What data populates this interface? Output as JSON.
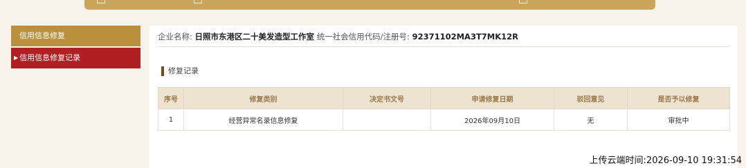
{
  "sidebar": {
    "items": [
      {
        "label": "信用信息修复"
      },
      {
        "label": "信用信息修复记录"
      }
    ]
  },
  "company": {
    "name_label": "企业名称:",
    "name_value": "日照市东港区二十美发造型工作室",
    "code_label": "统一社会信用代码/注册号:",
    "code_value": "92371102MA3T7MK12R"
  },
  "section": {
    "title": "修复记录"
  },
  "table": {
    "headers": [
      "序号",
      "修复类别",
      "决定书文号",
      "申请修复日期",
      "驳回意见",
      "是否予以修复"
    ],
    "rows": [
      [
        "1",
        "经营异常名录信息修复",
        "",
        "2026年09月10日",
        "无",
        "审批中"
      ]
    ]
  },
  "footer": {
    "upload_time": "上传云端时间:2026-09-10 19:31:54"
  },
  "colors": {
    "gold": "#b9903c",
    "red": "#b11f22",
    "banner": "#c9a45a"
  }
}
